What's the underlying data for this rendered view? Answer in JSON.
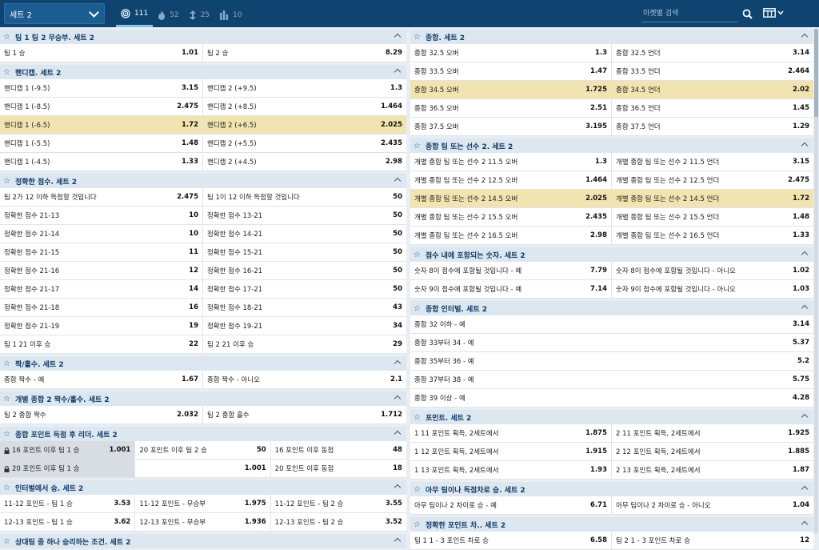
{
  "toolbar": {
    "set_select": "세트 2",
    "tabs": [
      {
        "icon": "target-icon",
        "count": "111",
        "active": true
      },
      {
        "icon": "fire-icon",
        "count": "52",
        "active": false
      },
      {
        "icon": "arrows-icon",
        "count": "25",
        "active": false
      },
      {
        "icon": "columns-icon",
        "count": "10",
        "active": false
      }
    ],
    "search_placeholder": "마켓별 검색"
  },
  "colors": {
    "topbar": "#0f4470",
    "header": "#dde7f0",
    "highlight": "#f1e4b0"
  },
  "left_markets": [
    {
      "title": "팀 1 팀 2 무승부. 세트 2",
      "cols": 2,
      "rows": [
        [
          [
            "팀 1 승",
            "1.01"
          ],
          [
            "팀 2 승",
            "8.29"
          ]
        ]
      ]
    },
    {
      "title": "핸디캡. 세트 2",
      "cols": 2,
      "rows": [
        [
          [
            "핸디캡 1 (-9.5)",
            "3.15"
          ],
          [
            "핸디캡 2 (+9.5)",
            "1.3"
          ]
        ],
        [
          [
            "핸디캡 1 (-8.5)",
            "2.475"
          ],
          [
            "핸디캡 2 (+8.5)",
            "1.464"
          ]
        ],
        [
          [
            "핸디캡 1 (-6.5)",
            "1.72",
            "hl"
          ],
          [
            "핸디캡 2 (+6.5)",
            "2.025",
            "hl"
          ]
        ],
        [
          [
            "핸디캡 1 (-5.5)",
            "1.48"
          ],
          [
            "핸디캡 2 (+5.5)",
            "2.435"
          ]
        ],
        [
          [
            "핸디캡 1 (-4.5)",
            "1.33"
          ],
          [
            "핸디캡 2 (+4.5)",
            "2.98"
          ]
        ]
      ]
    },
    {
      "title": "정확한 점수. 세트 2",
      "cols": 2,
      "rows": [
        [
          [
            "팀 2가 12 이하 득점할 것입니다",
            "2.475"
          ],
          [
            "팀 1이 12 이하 득점할 것입니다",
            "50"
          ]
        ],
        [
          [
            "정확한 점수 21-13",
            "10"
          ],
          [
            "정확한 점수 13-21",
            "50"
          ]
        ],
        [
          [
            "정확한 점수 21-14",
            "10"
          ],
          [
            "정확한 점수 14-21",
            "50"
          ]
        ],
        [
          [
            "정확한 점수 21-15",
            "11"
          ],
          [
            "정확한 점수 15-21",
            "50"
          ]
        ],
        [
          [
            "정확한 점수 21-16",
            "12"
          ],
          [
            "정확한 점수 16-21",
            "50"
          ]
        ],
        [
          [
            "정확한 점수 21-17",
            "14"
          ],
          [
            "정확한 점수 17-21",
            "50"
          ]
        ],
        [
          [
            "정확한 점수 21-18",
            "16"
          ],
          [
            "정확한 점수 18-21",
            "43"
          ]
        ],
        [
          [
            "정확한 점수 21-19",
            "19"
          ],
          [
            "정확한 점수 19-21",
            "34"
          ]
        ],
        [
          [
            "팀 1 21 이후 승",
            "22"
          ],
          [
            "팀 2 21 이후 승",
            "29"
          ]
        ]
      ]
    },
    {
      "title": "짝/홀수. 세트 2",
      "cols": 2,
      "rows": [
        [
          [
            "종합 짝수 - 예",
            "1.67"
          ],
          [
            "종합 짝수 - 아니오",
            "2.1"
          ]
        ]
      ]
    },
    {
      "title": "개별 종합 2 짝수/홀수. 세트 2",
      "cols": 2,
      "rows": [
        [
          [
            "팀 2 종합 짝수",
            "2.032"
          ],
          [
            "팀 2 종합 홀수",
            "1.712"
          ]
        ]
      ]
    },
    {
      "title": "종합 포인트 득점 후 리더. 세트 2",
      "cols": 3,
      "rows": [
        [
          [
            "16 포인트 이후 팀 1 승",
            "1.001",
            "dis"
          ],
          [
            "20 포인트 이후 팀 2 승",
            "50"
          ],
          [
            "16 포인트 이후 동점",
            "48"
          ]
        ],
        [
          [
            "20 포인트 이후 팀 1 승",
            "",
            "dis"
          ],
          [
            "",
            "1.001"
          ],
          [
            "20 포인트 이후 동점",
            "18"
          ]
        ]
      ]
    },
    {
      "title": "인터벌에서 승. 세트 2",
      "cols": 3,
      "rows": [
        [
          [
            "11-12 포인트 - 팀 1 승",
            "3.53"
          ],
          [
            "11-12 포인트 - 무승부",
            "1.975"
          ],
          [
            "11-12 포인트 - 팀 2 승",
            "3.55"
          ]
        ],
        [
          [
            "12-13 포인트 - 팀 1 승",
            "3.62"
          ],
          [
            "12-13 포인트 - 무승부",
            "1.936"
          ],
          [
            "12-13 포인트 - 팀 2 승",
            "3.52"
          ]
        ]
      ]
    },
    {
      "title": "상대팀 중 하나 승리하는 조건. 세트 2",
      "cols": 2,
      "rows": []
    }
  ],
  "right_markets": [
    {
      "title": "종합. 세트 2",
      "cols": 2,
      "rows": [
        [
          [
            "종합 32.5 오버",
            "1.3"
          ],
          [
            "종합 32.5 언더",
            "3.14"
          ]
        ],
        [
          [
            "종합 33.5 오버",
            "1.47"
          ],
          [
            "종합 33.5 언더",
            "2.464"
          ]
        ],
        [
          [
            "종합 34.5 오버",
            "1.725",
            "hl"
          ],
          [
            "종합 34.5 언더",
            "2.02",
            "hl"
          ]
        ],
        [
          [
            "종합 36.5 오버",
            "2.51"
          ],
          [
            "종합 36.5 언더",
            "1.45"
          ]
        ],
        [
          [
            "종합 37.5 오버",
            "3.195"
          ],
          [
            "종합 37.5 언더",
            "1.29"
          ]
        ]
      ]
    },
    {
      "title": "종합 팀 또는 선수 2. 세트 2",
      "cols": 2,
      "rows": [
        [
          [
            "개별 종합 팀 또는 선수 2 11.5 오버",
            "1.3"
          ],
          [
            "개별 종합 팀 또는 선수 2 11.5 언더",
            "3.15"
          ]
        ],
        [
          [
            "개별 종합 팀 또는 선수 2 12.5 오버",
            "1.464"
          ],
          [
            "개별 종합 팀 또는 선수 2 12.5 언더",
            "2.475"
          ]
        ],
        [
          [
            "개별 종합 팀 또는 선수 2 14.5 오버",
            "2.025",
            "hl"
          ],
          [
            "개별 종합 팀 또는 선수 2 14.5 언더",
            "1.72",
            "hl"
          ]
        ],
        [
          [
            "개별 종합 팀 또는 선수 2 15.5 오버",
            "2.435"
          ],
          [
            "개별 종합 팀 또는 선수 2 15.5 언더",
            "1.48"
          ]
        ],
        [
          [
            "개별 종합 팀 또는 선수 2 16.5 오버",
            "2.98"
          ],
          [
            "개별 종합 팀 또는 선수 2 16.5 언더",
            "1.33"
          ]
        ]
      ]
    },
    {
      "title": "점수 내에 포함되는 숫자. 세트 2",
      "cols": 2,
      "rows": [
        [
          [
            "숫자 8이 점수에 포함될 것입니다 - 예",
            "7.79"
          ],
          [
            "숫자 8이 점수에 포함될 것입니다 - 아니오",
            "1.02"
          ]
        ],
        [
          [
            "숫자 9이 점수에 포함될 것입니다 - 예",
            "7.14"
          ],
          [
            "숫자 9이 점수에 포함될 것입니다 - 아니오",
            "1.03"
          ]
        ]
      ]
    },
    {
      "title": "종합 인터벌. 세트 2",
      "cols": 1,
      "rows": [
        [
          [
            "종합 32 이하 - 예",
            "3.14"
          ]
        ],
        [
          [
            "종합 33부터 34 - 예",
            "5.37"
          ]
        ],
        [
          [
            "종합 35부터 36 - 예",
            "5.2"
          ]
        ],
        [
          [
            "종합 37부터 38 - 예",
            "5.75"
          ]
        ],
        [
          [
            "종합 39 이상 - 예",
            "4.28"
          ]
        ]
      ]
    },
    {
      "title": "포인트. 세트 2",
      "cols": 2,
      "rows": [
        [
          [
            "1 11 포인트 획득, 2세트에서",
            "1.875"
          ],
          [
            "2 11 포인트 획득, 2세트에서",
            "1.925"
          ]
        ],
        [
          [
            "1 12 포인트 획득, 2세트에서",
            "1.915"
          ],
          [
            "2 12 포인트 획득, 2세트에서",
            "1.885"
          ]
        ],
        [
          [
            "1 13 포인트 획득, 2세트에서",
            "1.93"
          ],
          [
            "2 13 포인트 획득, 2세트에서",
            "1.87"
          ]
        ]
      ]
    },
    {
      "title": "아무 팀이나 독점차로 승. 세트 2",
      "cols": 2,
      "rows": [
        [
          [
            "아무 팀이나 2 차이로 승 - 예",
            "6.71"
          ],
          [
            "아무 팀이나 2 차이로 승 - 아니오",
            "1.04"
          ]
        ]
      ]
    },
    {
      "title": "정확한 포인트 차.. 세트 2",
      "cols": 2,
      "rows": [
        [
          [
            "팀 1 1 - 3 포인트 차로 승",
            "6.58"
          ],
          [
            "팀 2 1 - 3 포인트 차로 승",
            "12"
          ]
        ]
      ]
    }
  ]
}
